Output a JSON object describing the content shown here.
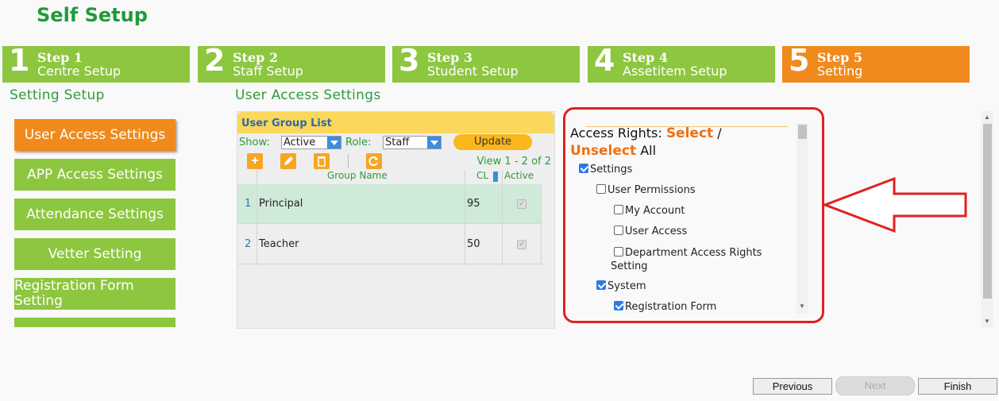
{
  "page": {
    "title": "Self Setup"
  },
  "steps": [
    {
      "num": "1",
      "title": "Step 1",
      "subtitle": "Centre Setup",
      "active": false
    },
    {
      "num": "2",
      "title": "Step 2",
      "subtitle": "Staff Setup",
      "active": false
    },
    {
      "num": "3",
      "title": "Step 3",
      "subtitle": "Student Setup",
      "active": false
    },
    {
      "num": "4",
      "title": "Step 4",
      "subtitle": "Assetitem Setup",
      "active": false
    },
    {
      "num": "5",
      "title": "Step 5",
      "subtitle": "Setting",
      "active": true
    }
  ],
  "left_section": {
    "title": "Setting Setup"
  },
  "menu": {
    "items": [
      {
        "label": "User Access Settings",
        "active": true
      },
      {
        "label": "APP Access Settings",
        "active": false
      },
      {
        "label": "Attendance Settings",
        "active": false
      },
      {
        "label": "Vetter Setting",
        "active": false
      },
      {
        "label": "Registration Form Setting",
        "active": false
      }
    ]
  },
  "main_section": {
    "title": "User Access Settings"
  },
  "user_group_list": {
    "title": "User Group List",
    "show_label": "Show:",
    "show_value": "Active",
    "role_label": "Role:",
    "role_value": "Staff",
    "update_label": "Update",
    "view_info": "View 1 - 2 of 2",
    "columns": {
      "group_name": "Group Name",
      "cl": "CL",
      "active": "Active"
    },
    "rows": [
      {
        "num": "1",
        "group_name": "Principal",
        "cl": "95",
        "active": true,
        "selected": true
      },
      {
        "num": "2",
        "group_name": "Teacher",
        "cl": "50",
        "active": true,
        "selected": false
      }
    ],
    "toolbar_icons": [
      "add-icon",
      "edit-icon",
      "delete-icon",
      "refresh-icon"
    ]
  },
  "access_rights": {
    "label": "Access Rights:",
    "select_label": "Select",
    "separator": " /",
    "unselect_label": "Unselect",
    "all_label": " All",
    "tree": [
      {
        "label": "Settings",
        "checked": true,
        "level": 0
      },
      {
        "label": "User Permissions",
        "checked": false,
        "level": 1
      },
      {
        "label": "My Account",
        "checked": false,
        "level": 2
      },
      {
        "label": "User Access",
        "checked": false,
        "level": 2
      },
      {
        "label": "Department Access Rights Setting",
        "checked": false,
        "level": 2
      },
      {
        "label": "System",
        "checked": true,
        "level": 1
      },
      {
        "label": "Registration Form",
        "checked": true,
        "level": 2
      }
    ]
  },
  "nav": {
    "previous": "Previous",
    "next": "Next",
    "finish": "Finish"
  },
  "colors": {
    "green": "#8dc63f",
    "orange": "#f08a1c",
    "title_green": "#1e9b3c",
    "highlight_red": "#e02020"
  }
}
